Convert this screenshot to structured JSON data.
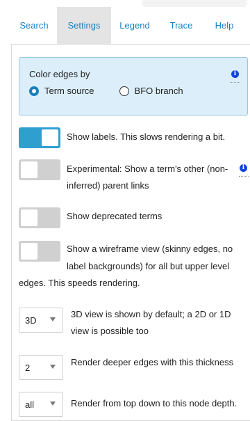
{
  "tabs": [
    {
      "label": "Search"
    },
    {
      "label": "Settings",
      "active": true
    },
    {
      "label": "Legend"
    },
    {
      "label": "Trace"
    },
    {
      "label": "Help"
    }
  ],
  "color_edges": {
    "title": "Color edges by",
    "options": [
      {
        "label": "Term source",
        "selected": true
      },
      {
        "label": "BFO branch",
        "selected": false
      }
    ],
    "info_glyph": "i"
  },
  "toggles": [
    {
      "label": "Show labels. This slows rendering a bit.",
      "on": true
    },
    {
      "label_line1": "Experimental: Show a term's other (non-",
      "label_line2": "inferred) parent links",
      "on": false,
      "info_glyph": "i"
    },
    {
      "label": "Show deprecated terms",
      "on": false
    },
    {
      "label_line1": "Show a wireframe view (skinny edges, no",
      "label_line2": "label backgrounds) for all but upper level",
      "label_line3": "edges. This speeds rendering.",
      "on": false
    }
  ],
  "selects": [
    {
      "value": "3D",
      "label_line1": "3D view is shown by default; a 2D or 1D",
      "label_line2": "view is possible too"
    },
    {
      "value": "2",
      "label_line1": "Render deeper edges with this thickness"
    },
    {
      "value": "all",
      "label_line1": "Render from top down to this node depth."
    }
  ],
  "colors": {
    "accent": "#1a7fbf",
    "toggle_on": "#2f9fd0",
    "panel_bg": "#dbeef9",
    "info": "#1144dd"
  }
}
